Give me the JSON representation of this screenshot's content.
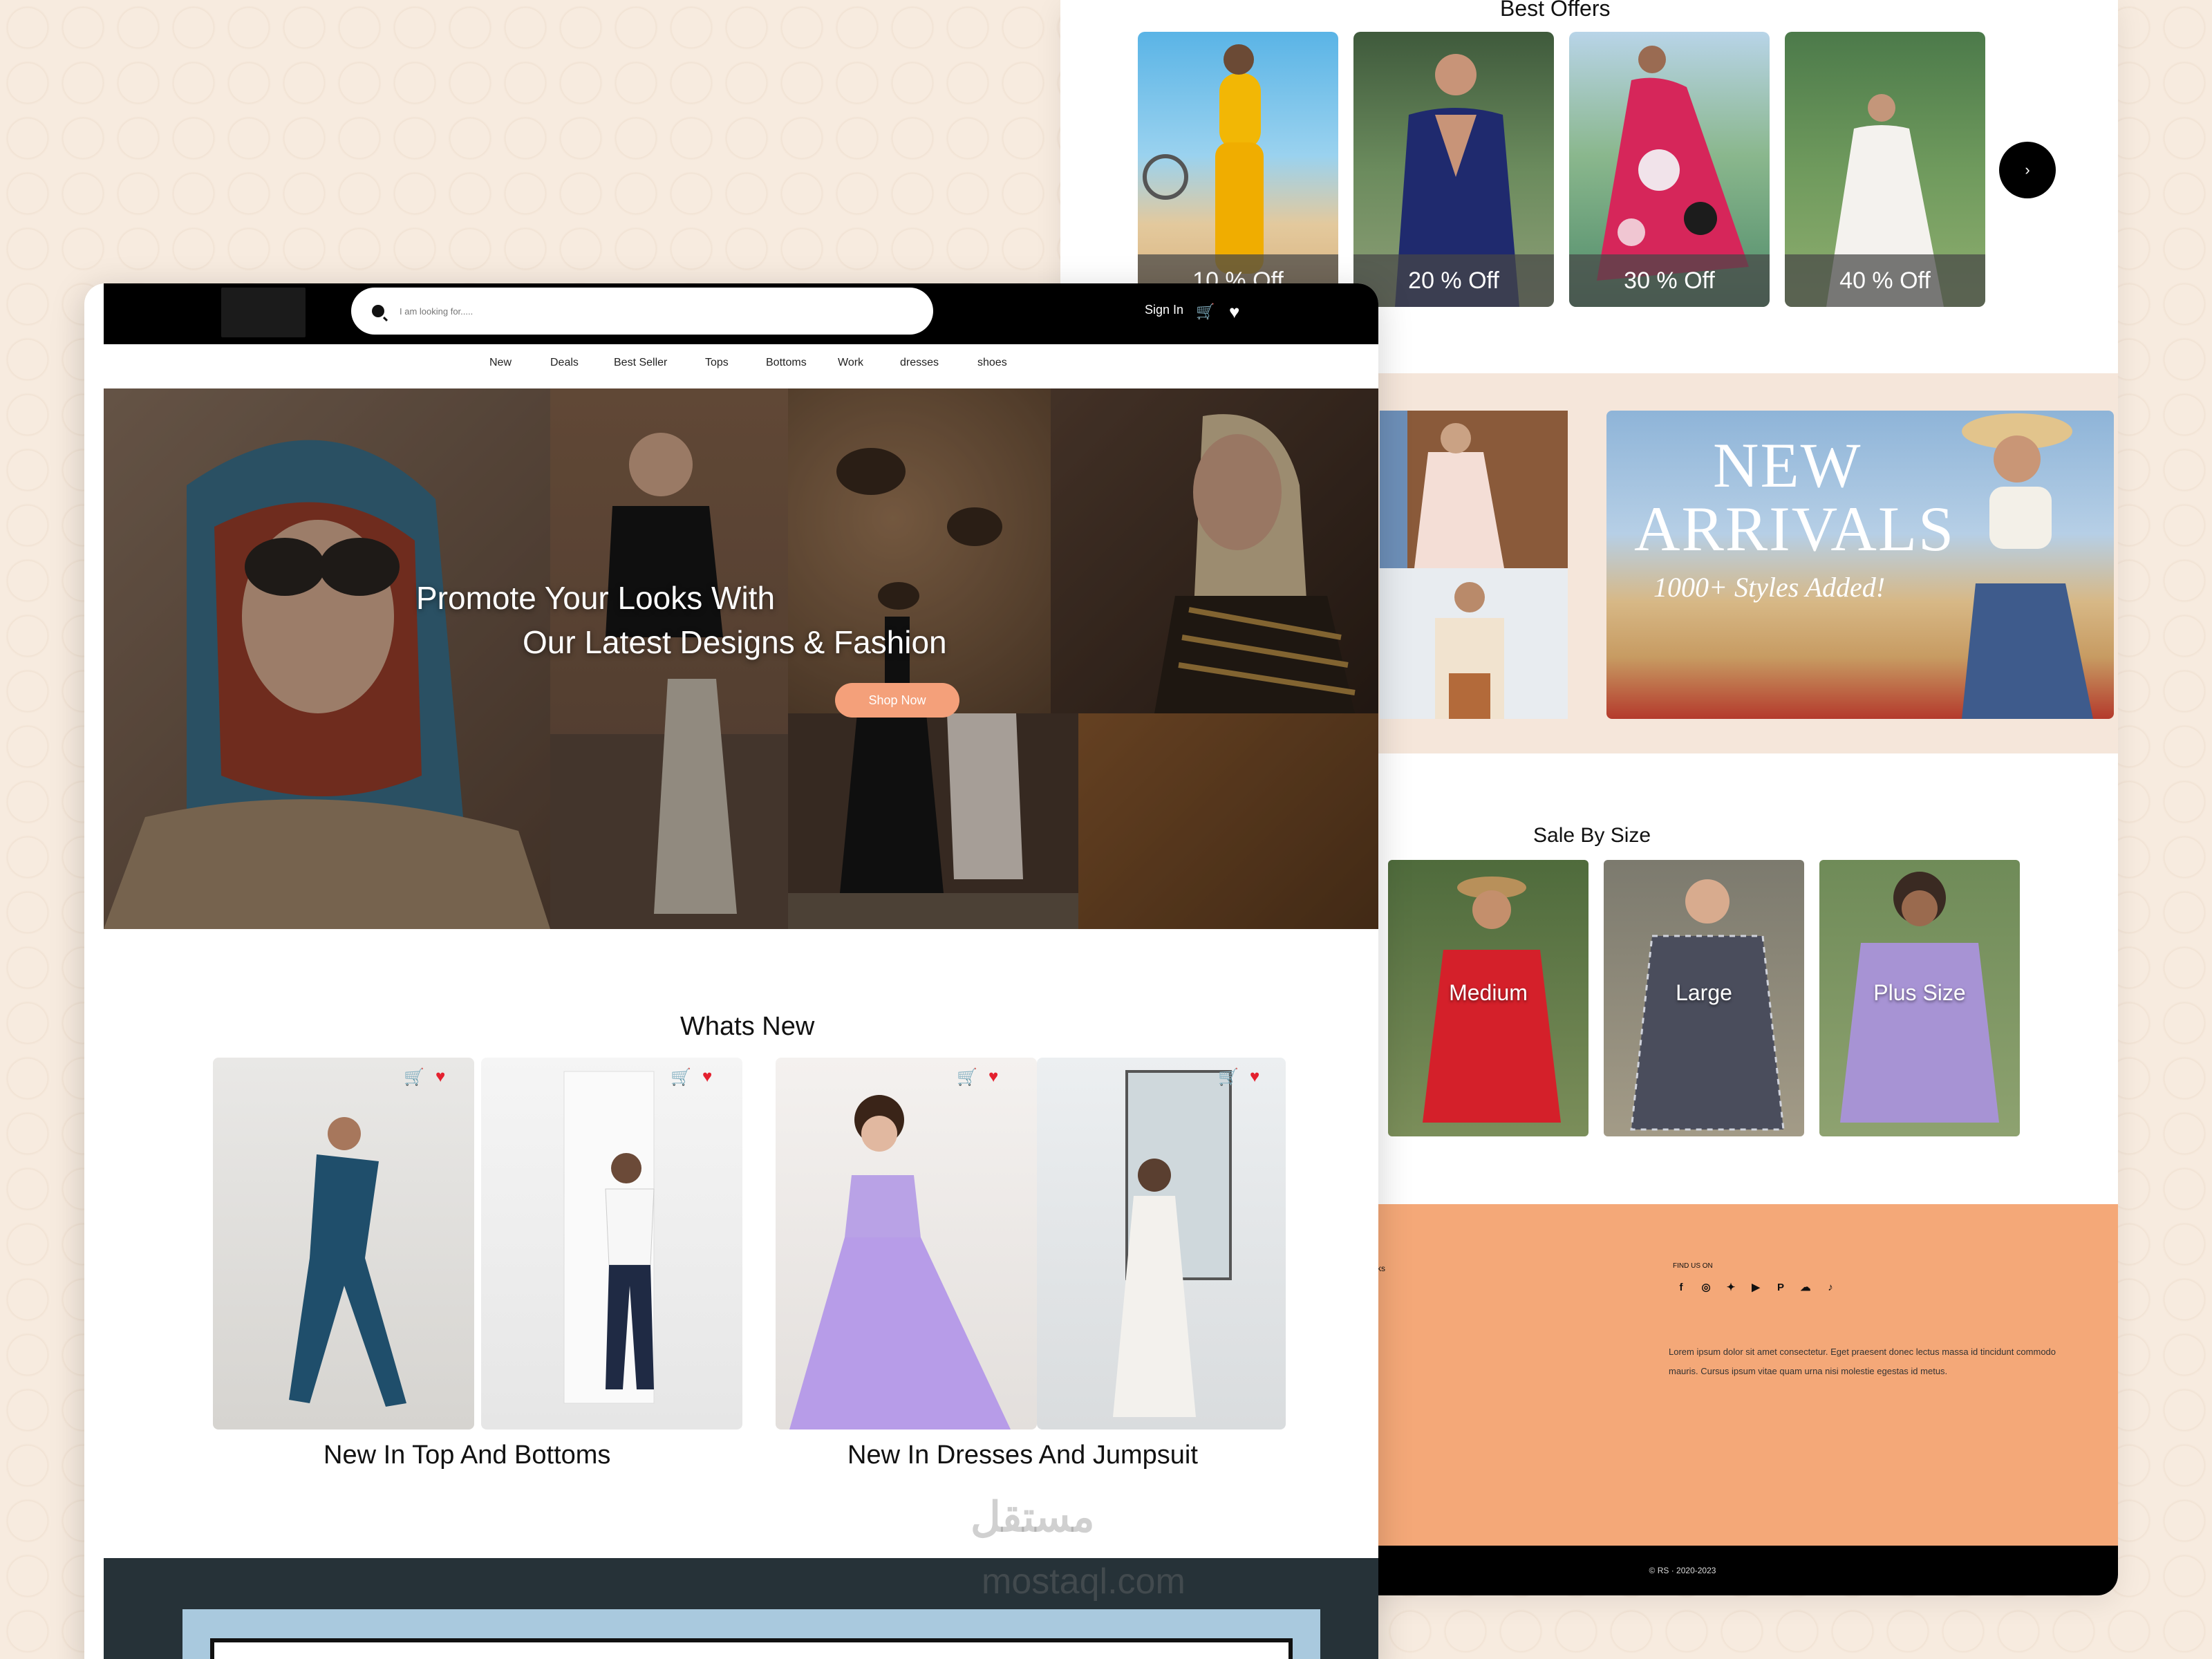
{
  "back_window": {
    "offers_title": "Best Offers",
    "offers": [
      {
        "label": "10 % Off"
      },
      {
        "label": "20 % Off"
      },
      {
        "label": "30 % Off"
      },
      {
        "label": "40 % Off"
      }
    ],
    "next_icon": "chevron-right-icon",
    "new_arrivals": {
      "line1": "NEW",
      "line2": "ARRIVALS",
      "line3": "1000+ Styles Added!"
    },
    "size_title": "Sale By Size",
    "sizes": [
      {
        "label": "Medium"
      },
      {
        "label": "Large"
      },
      {
        "label": "Plus Size"
      }
    ],
    "footer": {
      "edge_text": "ks",
      "find_us": "FIND US ON",
      "social_icons": [
        "facebook-icon",
        "instagram-icon",
        "twitter-icon",
        "youtube-icon",
        "pinterest-icon",
        "snapchat-icon",
        "tiktok-icon"
      ],
      "paragraph": "Lorem ipsum dolor sit amet consectetur. Eget praesent donec lectus massa id tincidunt commodo mauris. Cursus ipsum vitae quam urna nisi molestie egestas id metus.",
      "copyright": "© RS · 2020-2023"
    }
  },
  "front_window": {
    "search_placeholder": "I am looking for.....",
    "sign_in": "Sign In",
    "nav": [
      "New",
      "Deals",
      "Best Seller",
      "Tops",
      "Bottoms",
      "Work",
      "dresses",
      "shoes"
    ],
    "hero": {
      "line1": "Promote Your Looks With",
      "line2": "Our Latest Designs & Fashion",
      "cta": "Shop Now"
    },
    "whats_new_title": "Whats New",
    "groups": [
      {
        "caption": "New In Top And Bottoms"
      },
      {
        "caption": "New In Dresses And Jumpsuit"
      }
    ]
  },
  "watermark": {
    "arabic": "مستقل",
    "latin": "mostaql.com"
  },
  "colors": {
    "accent": "#f4a07a",
    "footer": "#f4a878",
    "heart": "#e4212f",
    "dark": "#000000"
  }
}
